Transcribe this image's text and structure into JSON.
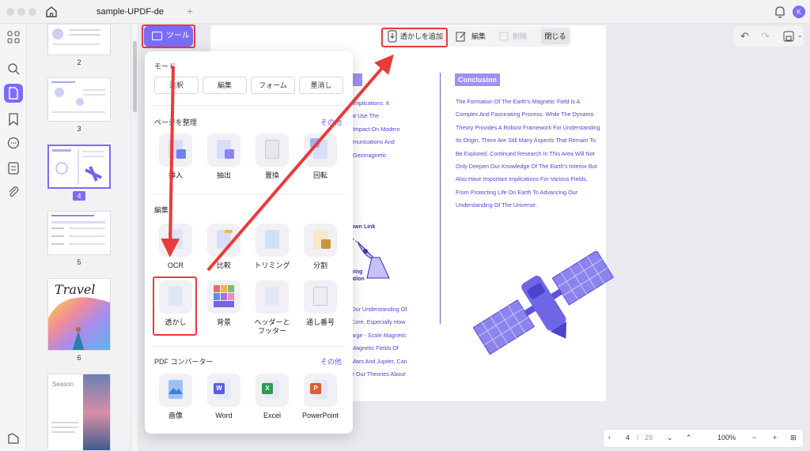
{
  "titlebar": {
    "doc_tab": "sample-UPDF-de",
    "avatar_letter": "K"
  },
  "toolbar": {
    "tools_label": "ツール",
    "add_watermark_label": "透かしを追加",
    "edit_label": "編集",
    "delete_label": "削除",
    "close_label": "閉じる"
  },
  "thumbnails": {
    "pages": [
      "2",
      "3",
      "4",
      "5",
      "6"
    ],
    "selected": "4",
    "travel_title": "Travel",
    "season_title": "Season"
  },
  "popup": {
    "mode_title": "モード",
    "mode_buttons": [
      "注釈",
      "編集",
      "フォーム",
      "墨消し"
    ],
    "organize_title": "ページを整理",
    "organize_more": "その他",
    "organize_items": [
      "挿入",
      "抽出",
      "置換",
      "回転"
    ],
    "edit_title": "編集",
    "edit_items_row1": [
      "OCR",
      "比較",
      "トリミング",
      "分割"
    ],
    "edit_items_row2": [
      "透かし",
      "背景",
      "ヘッダーと\nフッター",
      "通し番号"
    ],
    "converter_title": "PDF コンバーター",
    "converter_more": "その他",
    "converter_items": [
      "画像",
      "Word",
      "Excel",
      "PowerPoint"
    ]
  },
  "document": {
    "conclusion_title": "Conclusion",
    "conclusion_lines": [
      "The Formation Of The Earth's Magnetic Field Is A",
      "Complex And Fascinating Process. While The Dynamo",
      "Theory Provides A Robust Framework For Understanding",
      "Its Origin, There Are Still Many Aspects That Remain To",
      "Be Explored. Continued Research In This Area Will Not",
      "Only Deepen Our Knowledge Of The Earth's Interior But",
      "Also Have Important Implications For Various Fields,",
      "From Protecting Life On Earth To Advancing Our",
      "Understanding Of The Universe."
    ],
    "left_snips": [
      "g Implications. It",
      "hat Use The",
      "n Impact On Modern",
      "mmunications And",
      "g Geomagnetic"
    ],
    "left_snips2": [
      "Our Understanding Of",
      "Core, Especially How",
      "arge - Scale Magnetic",
      "Magnetic Fields Of",
      "Mars And Jupiter, Can",
      "e Our Theories About"
    ],
    "diagram_labels": [
      "own Link",
      "ving",
      "ation"
    ]
  },
  "bottombar": {
    "current_page": "4",
    "separator": "/",
    "total_pages": "29",
    "zoom": "100%"
  },
  "colors": {
    "accent": "#7b6cf6",
    "annotation_red": "#e83b3b",
    "doc_text": "#4f47d6"
  }
}
